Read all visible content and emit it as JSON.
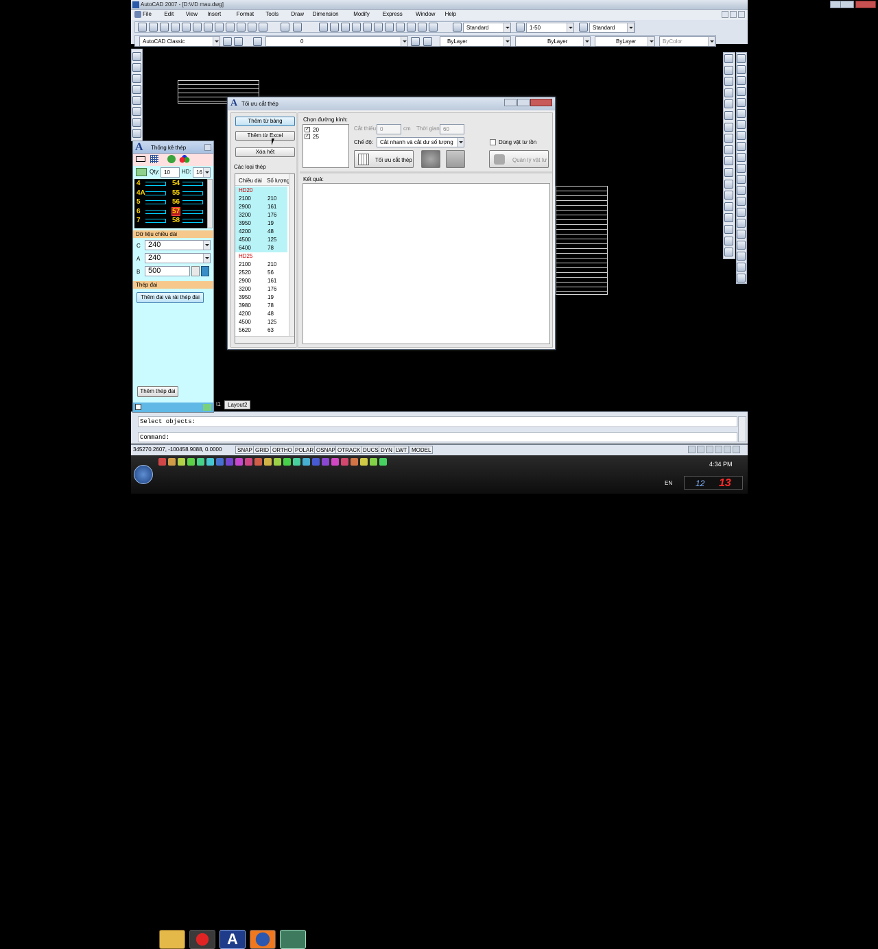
{
  "window_title": "AutoCAD 2007 - [D:\\VD mau.dwg]",
  "menu": [
    "File",
    "Edit",
    "View",
    "Insert",
    "Format",
    "Tools",
    "Draw",
    "Dimension",
    "Modify",
    "Express",
    "Window",
    "Help"
  ],
  "toolbar1": {
    "text_style": "Standard",
    "dim_style": "1-50",
    "table_style": "Standard"
  },
  "toolbar2": {
    "workspace": "AutoCAD Classic",
    "layer": "0",
    "color": "ByLayer",
    "linetype": "ByLayer",
    "lineweight": "ByLayer",
    "plotstyle": "ByColor"
  },
  "tabs": {
    "layout1_fragment": "t1",
    "layout2": "Layout2"
  },
  "command": {
    "line1": "Select objects:",
    "line2": "Command:"
  },
  "status": {
    "coords": "345270.2607, -100458.9088, 0.0000",
    "toggles": [
      "SNAP",
      "GRID",
      "ORTHO",
      "POLAR",
      "OSNAP",
      "OTRACK",
      "DUCS",
      "DYN",
      "LWT",
      "MODEL"
    ]
  },
  "thongke": {
    "title": "Thống kê thép",
    "qty_label": "Qty:",
    "qty_value": "10",
    "hd_label": "HD:",
    "hd_value": "16",
    "shapes": [
      {
        "l": "4",
        "r": "54"
      },
      {
        "l": "4A",
        "r": "55"
      },
      {
        "l": "5",
        "r": "56"
      },
      {
        "l": "6",
        "r": "57"
      },
      {
        "l": "7",
        "r": "58"
      }
    ],
    "length_section": "Dữ liệu chiều dài",
    "c_label": "C",
    "c_value": "240",
    "a_label": "A",
    "a_value": "240",
    "b_label": "B",
    "b_value": "500",
    "stirrup_section": "Thép đai",
    "add_stirrup_place": "Thêm đai và rải thép đai",
    "add_stirrup": "Thêm thép đai"
  },
  "toiuu": {
    "title": "Tối ưu cắt thép",
    "btn_from_table": "Thêm từ bảng",
    "btn_from_excel": "Thêm từ Excel",
    "btn_clear": "Xóa hết",
    "types_label": "Các loại thép",
    "col_length": "Chiều dài",
    "col_qty": "Số lượng",
    "groups": [
      {
        "name": "HD20",
        "rows": [
          [
            "2100",
            "210"
          ],
          [
            "2900",
            "161"
          ],
          [
            "3200",
            "176"
          ],
          [
            "3950",
            "19"
          ],
          [
            "4200",
            "48"
          ],
          [
            "4500",
            "125"
          ],
          [
            "6400",
            "78"
          ]
        ]
      },
      {
        "name": "HD25",
        "rows": [
          [
            "2100",
            "210"
          ],
          [
            "2520",
            "56"
          ],
          [
            "2900",
            "161"
          ],
          [
            "3200",
            "176"
          ],
          [
            "3950",
            "19"
          ],
          [
            "3980",
            "78"
          ],
          [
            "4200",
            "48"
          ],
          [
            "4500",
            "125"
          ],
          [
            "5620",
            "63"
          ]
        ]
      }
    ],
    "diameter_label": "Chọn đường kính:",
    "diameters": [
      "20",
      "25"
    ],
    "cut_label": "Cắt thiếu",
    "cut_value": "0",
    "cut_unit": "cm",
    "time_label": "Thời gian:",
    "time_value": "60",
    "mode_label": "Chế độ:",
    "mode_value": "Cắt nhanh và cắt dư số lượng",
    "optimize_btn": "Tối ưu cắt thép",
    "use_stock": "Dùng vật tư tồn",
    "manage_stock": "Quản lý vật tư",
    "result_label": "Kết quả:"
  },
  "tray": {
    "lang": "EN",
    "time": "4:34 PM",
    "clock_left": "12",
    "clock_right": "13"
  },
  "colors": {
    "title_bar": "#cfd9e6",
    "panel_cyan": "#ccfbff",
    "stirrup_header": "#f7c88b",
    "selection_cyan": "#b8f3f7",
    "hd_red": "#cc0000"
  }
}
